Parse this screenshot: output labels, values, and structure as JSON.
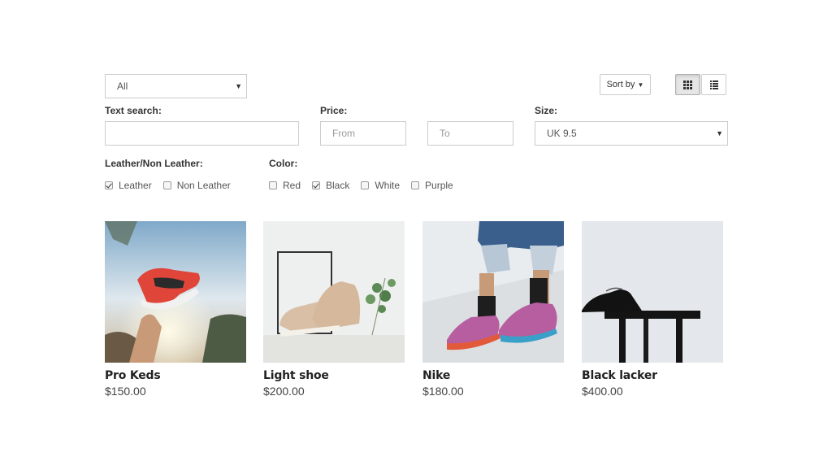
{
  "category_select": {
    "value": "All"
  },
  "sort_button": {
    "label": "Sort by"
  },
  "view_toggle": {
    "grid_icon": "grid-view-icon",
    "list_icon": "list-view-icon",
    "active": "grid"
  },
  "filters": {
    "text_search": {
      "label": "Text search:",
      "value": "",
      "placeholder": ""
    },
    "price": {
      "label": "Price:",
      "from_placeholder": "From",
      "to_placeholder": "To"
    },
    "size": {
      "label": "Size:",
      "value": "UK 9.5"
    },
    "material": {
      "label": "Leather/Non Leather:",
      "options": [
        {
          "label": "Leather",
          "checked": true
        },
        {
          "label": "Non Leather",
          "checked": false
        }
      ]
    },
    "color": {
      "label": "Color:",
      "options": [
        {
          "label": "Red",
          "checked": false
        },
        {
          "label": "Black",
          "checked": true
        },
        {
          "label": "White",
          "checked": false
        },
        {
          "label": "Purple",
          "checked": false
        }
      ]
    }
  },
  "products": [
    {
      "name": "Pro Keds",
      "price": "$150.00"
    },
    {
      "name": "Light shoe",
      "price": "$200.00"
    },
    {
      "name": "Nike",
      "price": "$180.00"
    },
    {
      "name": "Black lacker",
      "price": "$400.00"
    }
  ],
  "colors": {
    "border": "#cccccc",
    "text": "#333333",
    "muted": "#999999"
  }
}
